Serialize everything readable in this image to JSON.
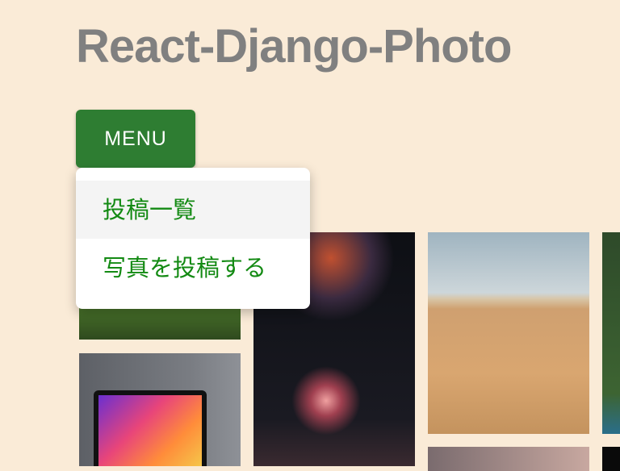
{
  "header": {
    "title": "React-Django-Photo"
  },
  "menu": {
    "button_label": "MENU",
    "items": [
      {
        "label": "投稿一覧"
      },
      {
        "label": "写真を投稿する"
      }
    ]
  },
  "colors": {
    "background": "#faebd7",
    "button": "#2e7d32",
    "menu_text": "#138a13",
    "title": "#808080"
  },
  "gallery": {
    "photos": [
      "forest",
      "fireworks",
      "desert",
      "aerial-forest",
      "laptop",
      "sunset",
      "night"
    ]
  }
}
